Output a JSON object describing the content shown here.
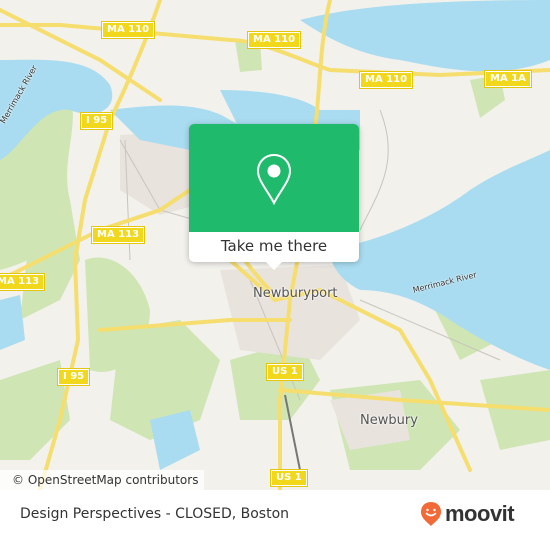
{
  "map": {
    "roads": [
      {
        "label": "MA 110",
        "kind": "shield"
      },
      {
        "label": "MA 110",
        "kind": "shield"
      },
      {
        "label": "MA 110",
        "kind": "shield"
      },
      {
        "label": "MA 1A",
        "kind": "shield"
      },
      {
        "label": "I 95",
        "kind": "shield"
      },
      {
        "label": "MA 113",
        "kind": "shield"
      },
      {
        "label": "MA 113",
        "kind": "shield"
      },
      {
        "label": "I 95",
        "kind": "shield"
      },
      {
        "label": "US 1",
        "kind": "shield"
      },
      {
        "label": "US 1",
        "kind": "shield"
      }
    ],
    "places": [
      "Newburyport",
      "Newbury"
    ],
    "water": [
      "Merrimack River",
      "Merrimack River"
    ],
    "attribution": "© OpenStreetMap contributors",
    "colors": {
      "water": "#a9dcf0",
      "land": "#f2f1ec",
      "park": "#cde8b0",
      "road": "#f5de6e",
      "accent": "#1fba6b"
    }
  },
  "popup": {
    "icon": "map-pin-icon",
    "cta_label": "Take me there"
  },
  "footer": {
    "title": "Design Perspectives - CLOSED, Boston",
    "brand": "moovit",
    "brand_icon": "moovit-pin-icon",
    "brand_color": "#f26a37"
  }
}
